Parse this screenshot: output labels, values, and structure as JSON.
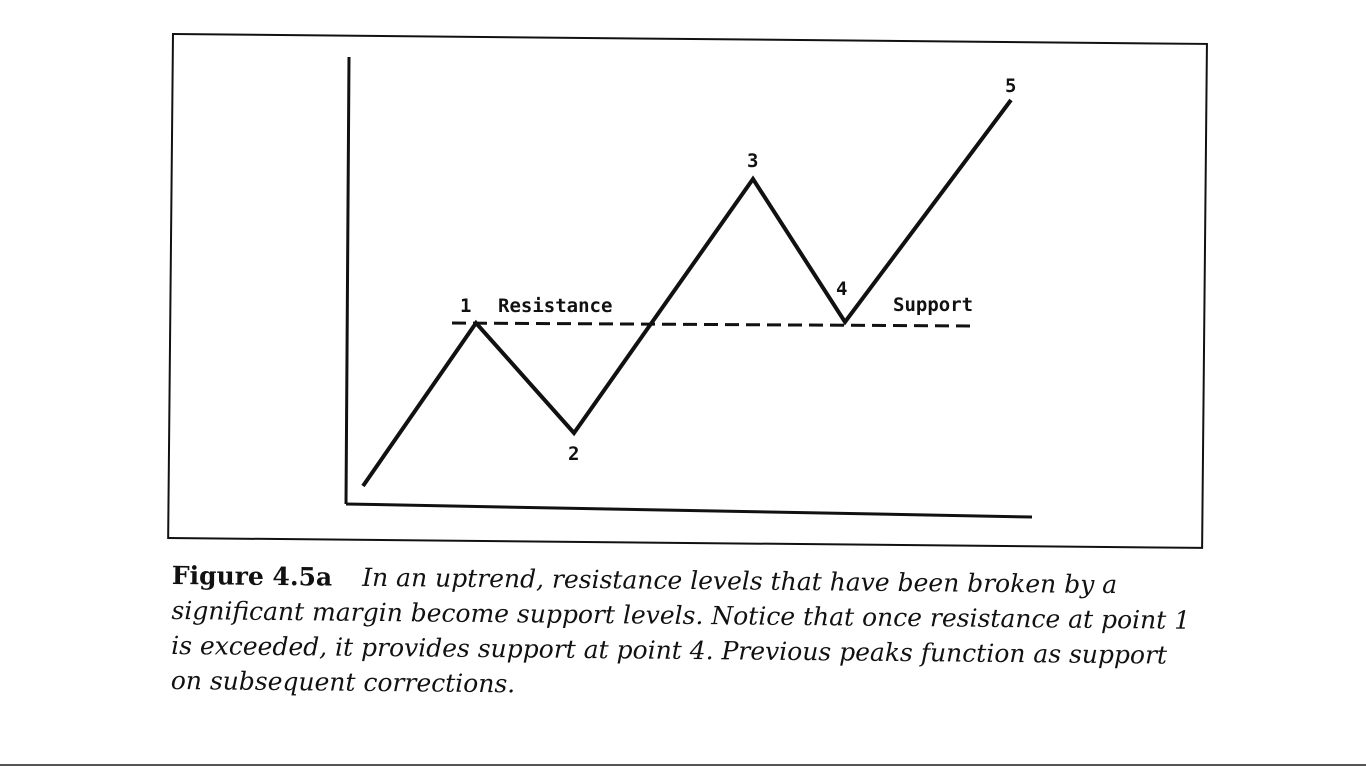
{
  "diagram": {
    "points": [
      {
        "id": "start",
        "label": ""
      },
      {
        "id": "p1",
        "label": "1"
      },
      {
        "id": "p2",
        "label": "2"
      },
      {
        "id": "p3",
        "label": "3"
      },
      {
        "id": "p4",
        "label": "4"
      },
      {
        "id": "p5",
        "label": "5"
      }
    ],
    "resistance_label": "Resistance",
    "support_label": "Support",
    "line_color": "#111111"
  },
  "caption": {
    "figure_number": "Figure 4.5a",
    "text": "In an uptrend, resistance levels that have been broken by a significant margin become support levels. Notice that once resistance at point 1 is exceeded, it provides support at point 4. Previous peaks function as support on subsequent corrections."
  }
}
